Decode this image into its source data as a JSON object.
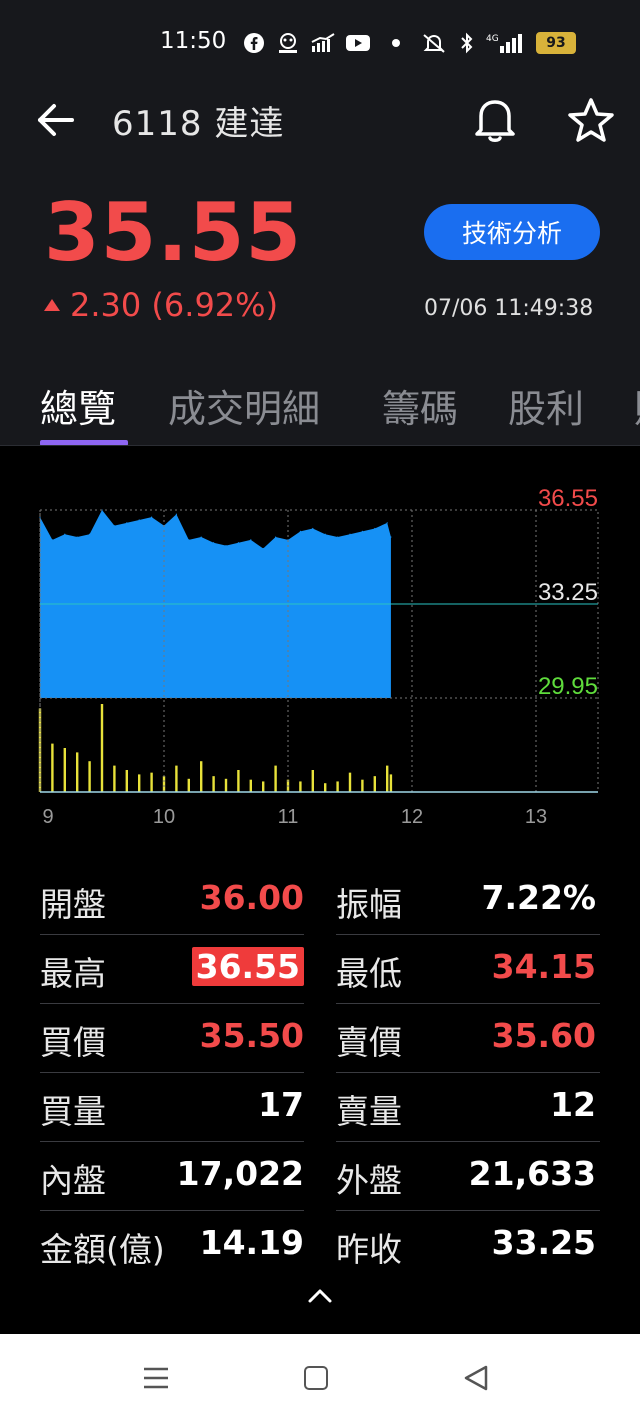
{
  "status_bar": {
    "time": "11:50",
    "network": "4G",
    "battery": "93",
    "icons": [
      "facebook-icon",
      "app-icon",
      "chart-app-icon",
      "youtube-icon",
      "dot-icon",
      "mute-icon",
      "bluetooth-icon",
      "signal-icon",
      "battery-icon"
    ]
  },
  "header": {
    "title": "6118 建達"
  },
  "quote": {
    "price": "35.55",
    "change": "2.30 (6.92%)",
    "tech_button": "技術分析",
    "datetime": "07/06 11:49:38"
  },
  "tabs": [
    "總覽",
    "成交明細",
    "籌碼",
    "股利",
    "財"
  ],
  "colors": {
    "up": "#f24b4b",
    "down_green": "#5fdc3c",
    "area": "#1691f5",
    "volume": "#e8e23a",
    "accent": "#1a6ef0",
    "tab_underline": "#8e66f2"
  },
  "chart_data": {
    "type": "area",
    "price_axis_labels": [
      "36.55",
      "33.25",
      "29.95"
    ],
    "ylim": [
      29.95,
      36.55
    ],
    "reference_price": 33.25,
    "x_ticks": [
      "9",
      "10",
      "11",
      "12",
      "13"
    ],
    "price_series": {
      "x": [
        9.0,
        9.1,
        9.2,
        9.3,
        9.4,
        9.5,
        9.6,
        9.7,
        9.8,
        9.9,
        10.0,
        10.1,
        10.2,
        10.3,
        10.4,
        10.5,
        10.6,
        10.7,
        10.8,
        10.9,
        11.0,
        11.1,
        11.2,
        11.3,
        11.4,
        11.5,
        11.6,
        11.7,
        11.8,
        11.83
      ],
      "values": [
        36.3,
        35.5,
        35.7,
        35.6,
        35.7,
        36.55,
        36.0,
        36.1,
        36.2,
        36.3,
        36.0,
        36.4,
        35.5,
        35.6,
        35.4,
        35.3,
        35.4,
        35.5,
        35.2,
        35.6,
        35.5,
        35.8,
        35.9,
        35.7,
        35.6,
        35.7,
        35.8,
        35.9,
        36.1,
        35.6
      ]
    },
    "volume_series": {
      "x": [
        9.0,
        9.1,
        9.2,
        9.3,
        9.4,
        9.5,
        9.6,
        9.7,
        9.8,
        9.9,
        10.0,
        10.1,
        10.2,
        10.3,
        10.4,
        10.5,
        10.6,
        10.7,
        10.8,
        10.9,
        11.0,
        11.1,
        11.2,
        11.3,
        11.4,
        11.5,
        11.6,
        11.7,
        11.8,
        11.83
      ],
      "values": [
        95,
        55,
        50,
        45,
        35,
        100,
        30,
        25,
        20,
        22,
        18,
        30,
        15,
        35,
        18,
        15,
        25,
        14,
        12,
        30,
        14,
        12,
        25,
        10,
        12,
        22,
        14,
        18,
        30,
        20
      ]
    }
  },
  "stats": [
    {
      "left_label": "開盤",
      "left_value": "36.00",
      "left_color": "red",
      "right_label": "振幅",
      "right_value": "7.22%",
      "right_color": "white"
    },
    {
      "left_label": "最高",
      "left_value": "36.55",
      "left_color": "highlight",
      "right_label": "最低",
      "right_value": "34.15",
      "right_color": "red"
    },
    {
      "left_label": "買價",
      "left_value": "35.50",
      "left_color": "red",
      "right_label": "賣價",
      "right_value": "35.60",
      "right_color": "red"
    },
    {
      "left_label": "買量",
      "left_value": "17",
      "left_color": "white",
      "right_label": "賣量",
      "right_value": "12",
      "right_color": "white"
    },
    {
      "left_label": "內盤",
      "left_value": "17,022",
      "left_color": "white",
      "right_label": "外盤",
      "right_value": "21,633",
      "right_color": "white"
    },
    {
      "left_label": "金額(億)",
      "left_value": "14.19",
      "left_color": "white",
      "right_label": "昨收",
      "right_value": "33.25",
      "right_color": "white"
    }
  ]
}
